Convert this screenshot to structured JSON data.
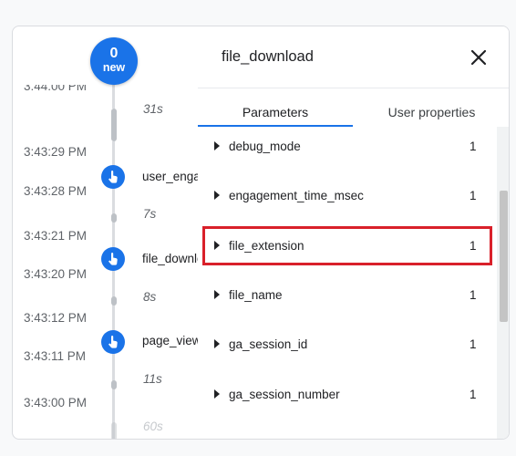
{
  "timeline": {
    "badge": {
      "count": "0",
      "label": "new"
    },
    "cut_time": "3:44:00 PM",
    "times": [
      "3:43:29 PM",
      "3:43:28 PM",
      "3:43:21 PM",
      "3:43:20 PM",
      "3:43:12 PM",
      "3:43:11 PM",
      "3:43:00 PM"
    ],
    "gaps": [
      "31s",
      "7s",
      "8s",
      "11s",
      "60s"
    ],
    "events": [
      "user_engagement",
      "file_download",
      "page_view"
    ]
  },
  "panel": {
    "title": "file_download",
    "tabs": [
      "Parameters",
      "User properties"
    ],
    "parameters": [
      {
        "name": "debug_mode",
        "value": "1"
      },
      {
        "name": "engagement_time_msec",
        "value": "1"
      },
      {
        "name": "file_extension",
        "value": "1"
      },
      {
        "name": "file_name",
        "value": "1"
      },
      {
        "name": "ga_session_id",
        "value": "1"
      },
      {
        "name": "ga_session_number",
        "value": "1"
      }
    ],
    "highlighted_parameter": "file_extension"
  },
  "colors": {
    "accent": "#1a73e8",
    "highlight": "#d9202a"
  },
  "icons": {
    "event": "touch-hand-icon",
    "close": "close-icon",
    "expand": "expand-arrow-icon"
  }
}
